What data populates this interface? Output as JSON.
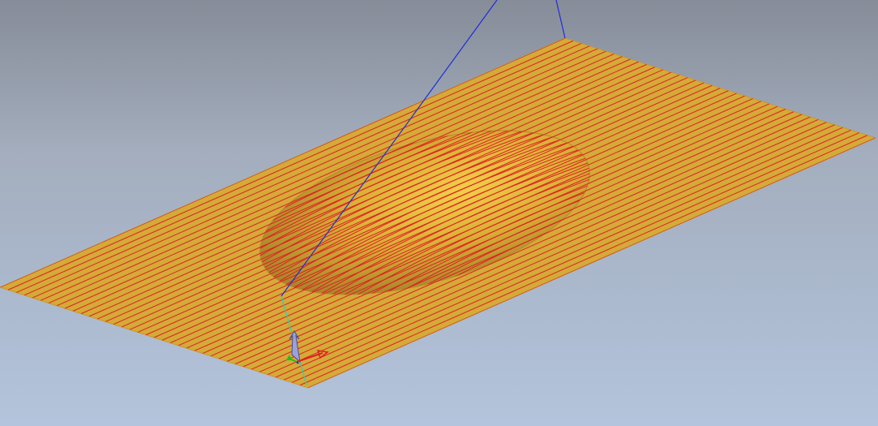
{
  "viewport": {
    "background_top": "#868c98",
    "background_bottom": "#b3c4dc"
  },
  "surface": {
    "fill_color": "#d4aa38",
    "toolpath_color": "#e02020",
    "toolpath_pass_count": 38,
    "feature": "raised-ellipsoid-bump"
  },
  "guide_line": {
    "color": "#1c2ed8"
  },
  "triad": {
    "x_axis_color": "#e02020",
    "y_axis_color": "#20c020",
    "z_axis_color": "#2030c0",
    "normal_axis_color": "#30d0b0",
    "tool_arrow_color": "#8088c8"
  }
}
